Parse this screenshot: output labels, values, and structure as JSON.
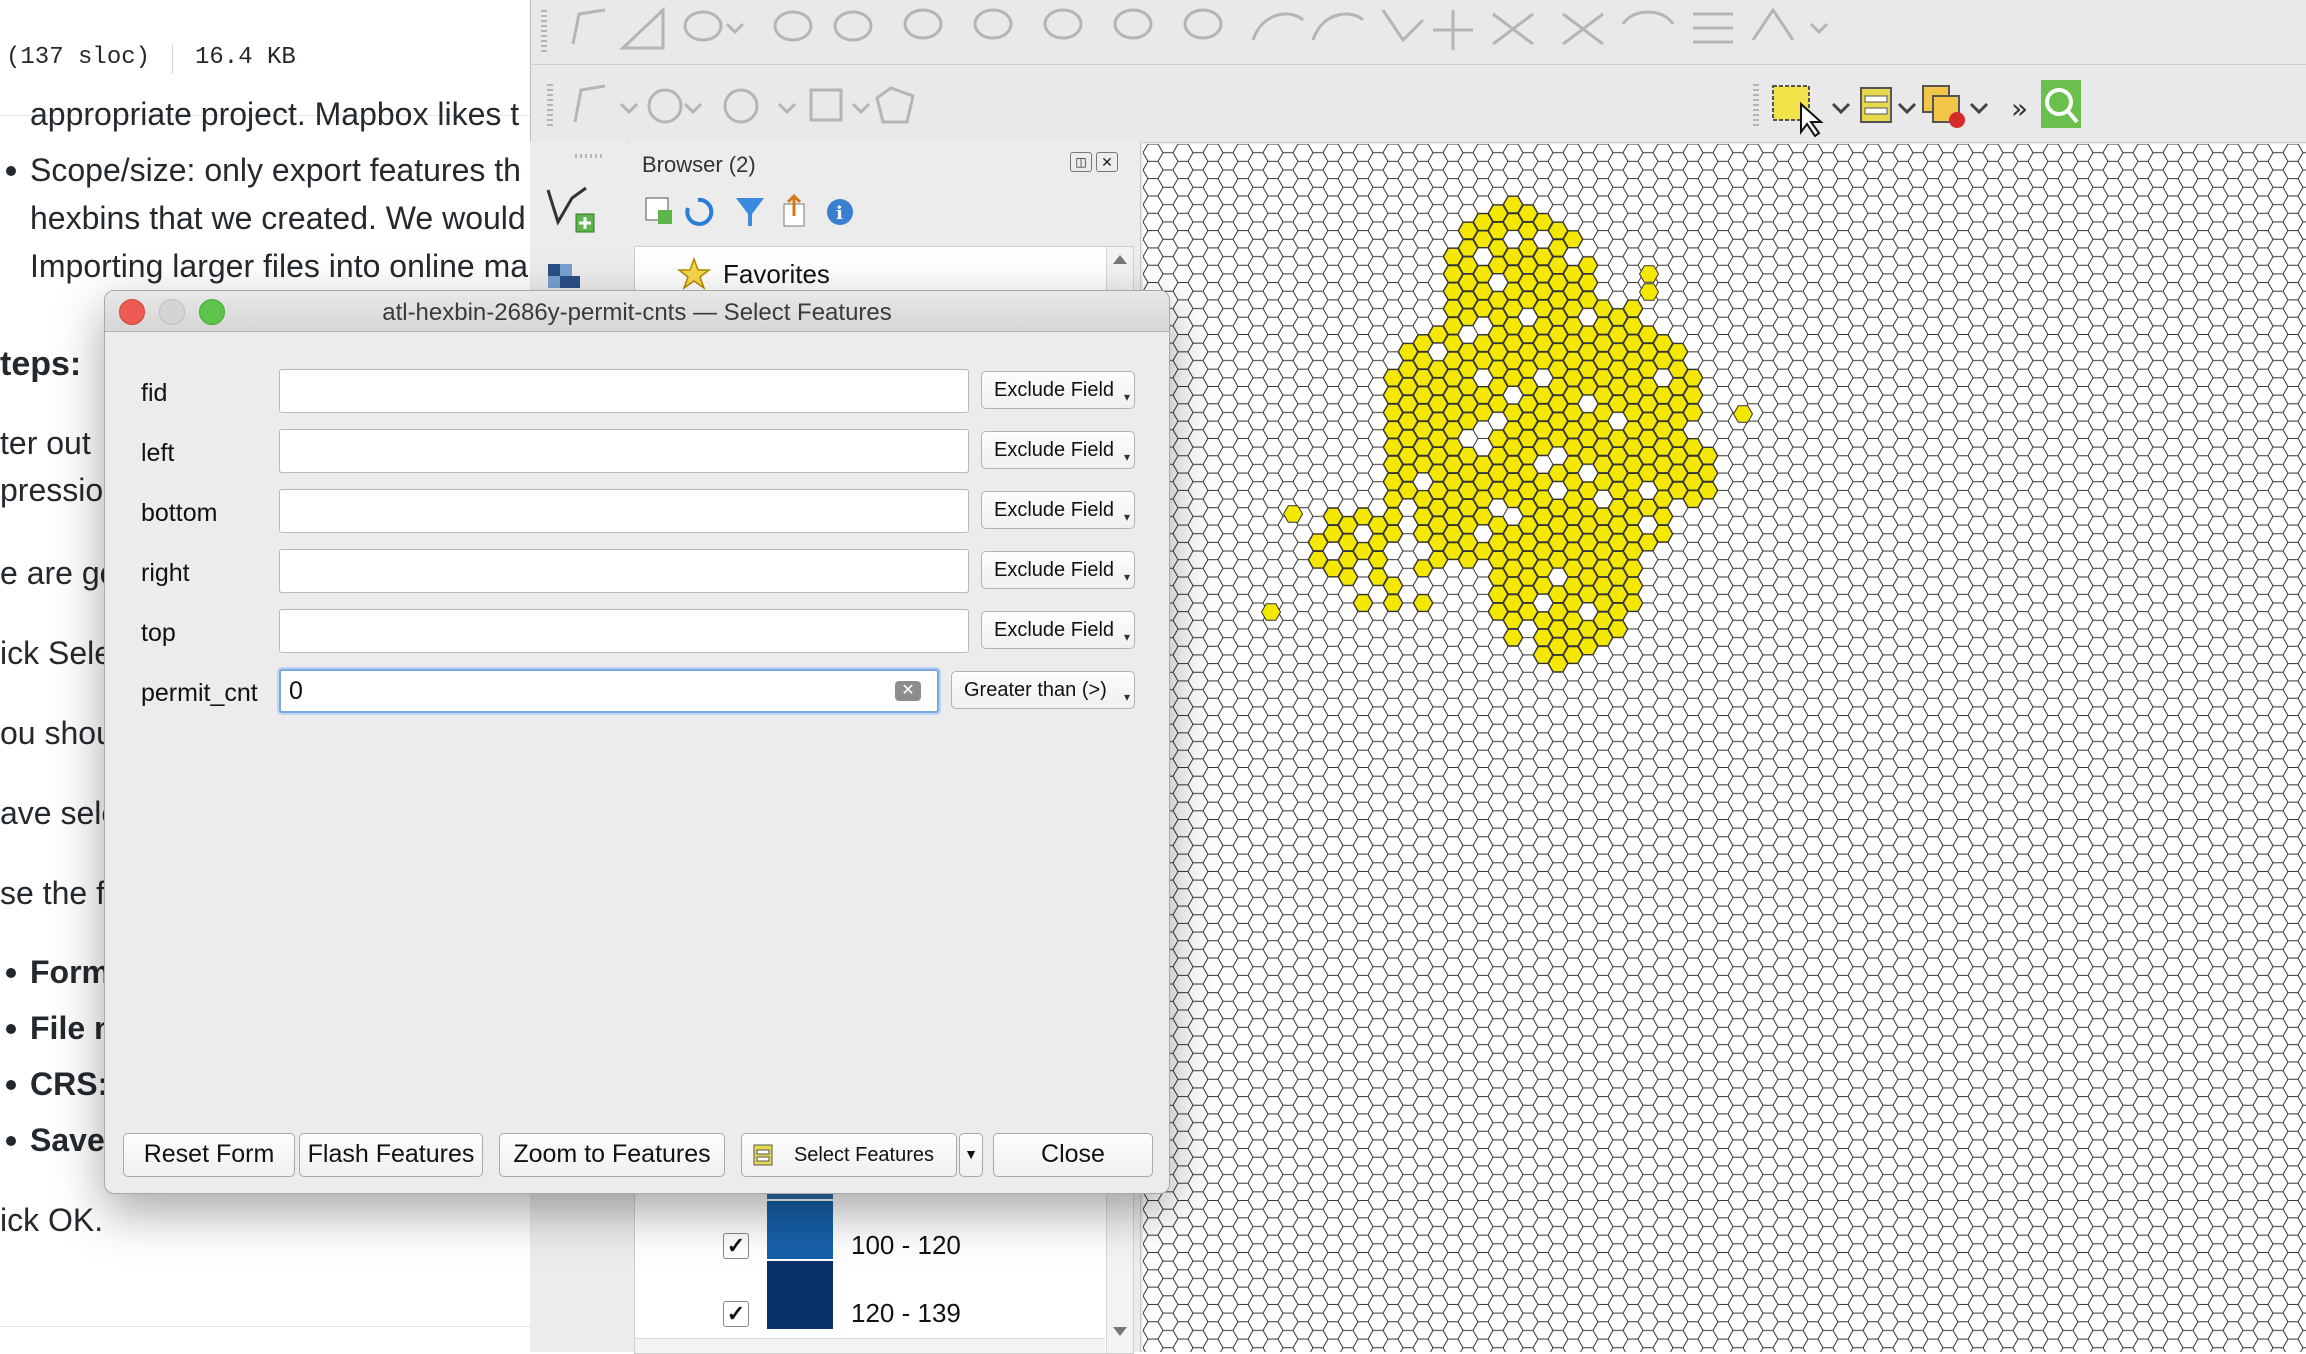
{
  "doc": {
    "header_left": "(137 sloc)",
    "header_right": "16.4 KB",
    "line1": "appropriate project. Mapbox likes t",
    "bullet1_line1": "Scope/size: only export features th",
    "bullet1_line2": "hexbins that we created. We would",
    "bullet1_line3": "Importing larger files into online ma",
    "heading": "teps:",
    "p1a": "ter out",
    "p1b": "pressio",
    "p2": "e are go",
    "p3": "ick Sele",
    "p4": "ou shoul",
    "p5": "ave sele",
    "p6": "se the fo",
    "b2": "Form",
    "b3": "File n",
    "b4": "CRS:",
    "b5": "Save",
    "p7": "ick OK."
  },
  "browser": {
    "title": "Browser (2)",
    "favorites": "Favorites"
  },
  "legend": {
    "items": [
      {
        "label": "100 - 120",
        "color": "#1660a9",
        "checked": "✓"
      },
      {
        "label": "120 - 139",
        "color": "#08306b",
        "checked": "✓"
      }
    ]
  },
  "dialog": {
    "title": "atl-hexbin-2686y-permit-cnts — Select Features",
    "fields": [
      {
        "label": "fid",
        "value": "",
        "operator": "Exclude Field"
      },
      {
        "label": "left",
        "value": "",
        "operator": "Exclude Field"
      },
      {
        "label": "bottom",
        "value": "",
        "operator": "Exclude Field"
      },
      {
        "label": "right",
        "value": "",
        "operator": "Exclude Field"
      },
      {
        "label": "top",
        "value": "",
        "operator": "Exclude Field"
      },
      {
        "label": "permit_cnt",
        "value": "0",
        "operator": "Greater than (>)"
      }
    ],
    "buttons": {
      "reset": "Reset Form",
      "flash": "Flash Features",
      "zoom": "Zoom to Features",
      "select": "Select Features",
      "close": "Close"
    }
  },
  "colors": {
    "selected_hex": "#f5e800",
    "hex_stroke": "#333333",
    "close_red": "#ec5b52",
    "max_green": "#5ec34a"
  },
  "icons": [
    "digitize-icon",
    "select-by-area-icon",
    "deselect-icon",
    "identify-icon"
  ]
}
